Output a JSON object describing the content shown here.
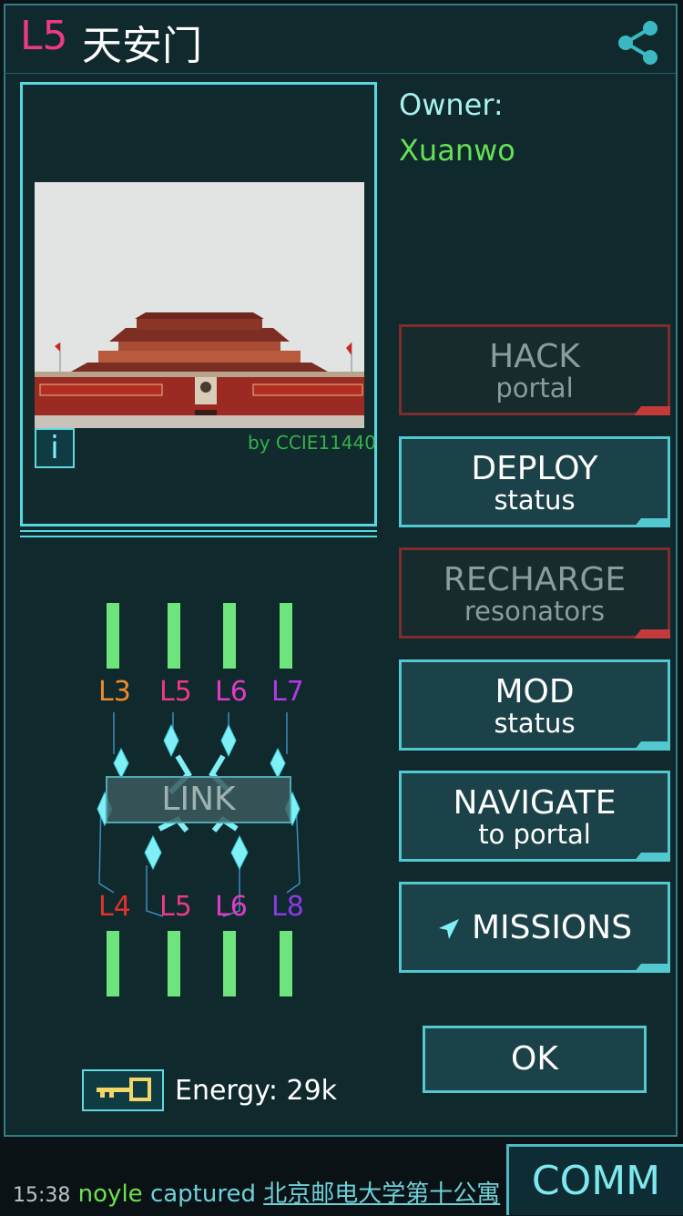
{
  "portal": {
    "level": "L5",
    "name": "天安门"
  },
  "owner": {
    "label": "Owner:",
    "name": "Xuanwo"
  },
  "photo": {
    "credit": "by CCIE11440",
    "info_label": "i"
  },
  "actions": [
    {
      "id": "hack",
      "line1": "HACK",
      "line2": "portal",
      "enabled": false
    },
    {
      "id": "deploy",
      "line1": "DEPLOY",
      "line2": "status",
      "enabled": true
    },
    {
      "id": "recharge",
      "line1": "RECHARGE",
      "line2": "resonators",
      "enabled": false
    },
    {
      "id": "mod",
      "line1": "MOD",
      "line2": "status",
      "enabled": true
    },
    {
      "id": "navigate",
      "line1": "NAVIGATE",
      "line2": "to portal",
      "enabled": true
    },
    {
      "id": "missions",
      "line1": "MISSIONS",
      "line2": "",
      "enabled": true
    }
  ],
  "resonators": {
    "top": [
      {
        "label": "L3",
        "color": "#f08a2e",
        "energy": 1.0
      },
      {
        "label": "L5",
        "color": "#ec3a86",
        "energy": 1.0
      },
      {
        "label": "L6",
        "color": "#e23ac8",
        "energy": 1.0
      },
      {
        "label": "L7",
        "color": "#b23ae6",
        "energy": 1.0
      }
    ],
    "bottom": [
      {
        "label": "L4",
        "color": "#e0322a",
        "energy": 1.0
      },
      {
        "label": "L5",
        "color": "#ec3a86",
        "energy": 1.0
      },
      {
        "label": "L6",
        "color": "#e23ac8",
        "energy": 1.0
      },
      {
        "label": "L8",
        "color": "#8a3ae6",
        "energy": 1.0
      }
    ],
    "bar_color": "#6ee47c"
  },
  "link_label": "LINK",
  "energy": {
    "label": "Energy: 29k"
  },
  "ok_label": "OK",
  "ticker": {
    "time": "15:38",
    "user": "noyle",
    "verb": "captured",
    "place": "北京邮电大学第十公寓"
  },
  "comm_label": "COMM",
  "icons": {
    "share": "share-icon",
    "key": "key-icon",
    "missions": "mission-arrow-icon",
    "info": "info-icon"
  },
  "colors": {
    "accent": "#52c8d0",
    "disabled_border": "#7e2c2c",
    "level": "#ec3a86",
    "owner_faction": "#65e055"
  }
}
